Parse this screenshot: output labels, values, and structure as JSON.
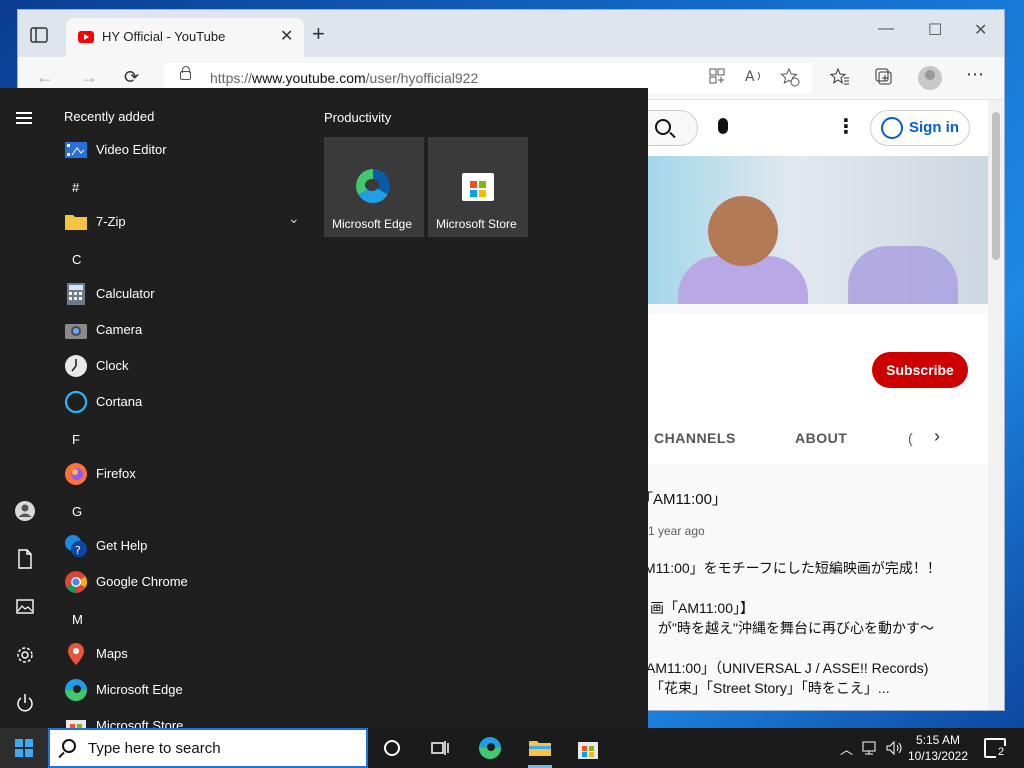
{
  "browser": {
    "tab_title": "HY Official - YouTube",
    "url_prefix": "https://",
    "url_host": "www.youtube.com",
    "url_path": "/user/hyofficial922",
    "close_tab": "✕",
    "new_tab": "+",
    "window_minimize": "—",
    "window_maximize": "☐",
    "window_close": "✕",
    "back": "←",
    "forward": "→",
    "refresh": "⟳",
    "more": "⋯"
  },
  "youtube": {
    "sign_in": "Sign in",
    "subscribe": "Subscribe",
    "tabs": [
      "CHANNELS",
      "ABOUT",
      "("
    ],
    "kebab": "⋮",
    "next": "›",
    "video_title": "「AM11:00」",
    "video_age": "1 year ago",
    "desc_lines": [
      "M11:00」をモチーフにした短編映画が完成！！",
      "画「AM11:00」】",
      "が\"時を越え\"沖縄を舞台に再び心を動かす～",
      "AM11:00」（UNIVERSAL J / ASSE!! Records)",
      "「花束」「Street Story」「時をこえ」..."
    ]
  },
  "start_menu": {
    "recently_added": "Recently added",
    "productivity": "Productivity",
    "apps": [
      {
        "label": "Video Editor",
        "icon": "video-editor-icon"
      },
      {
        "letter": "#"
      },
      {
        "label": "7-Zip",
        "icon": "folder-icon",
        "expand": "⌄"
      },
      {
        "letter": "C"
      },
      {
        "label": "Calculator",
        "icon": "calculator-icon"
      },
      {
        "label": "Camera",
        "icon": "camera-icon"
      },
      {
        "label": "Clock",
        "icon": "clock-icon"
      },
      {
        "label": "Cortana",
        "icon": "cortana-icon"
      },
      {
        "letter": "F"
      },
      {
        "label": "Firefox",
        "icon": "firefox-icon"
      },
      {
        "letter": "G"
      },
      {
        "label": "Get Help",
        "icon": "get-help-icon"
      },
      {
        "label": "Google Chrome",
        "icon": "chrome-icon"
      },
      {
        "letter": "M"
      },
      {
        "label": "Maps",
        "icon": "maps-icon"
      },
      {
        "label": "Microsoft Edge",
        "icon": "edge-icon"
      },
      {
        "label": "Microsoft Store",
        "icon": "store-icon"
      }
    ],
    "tiles": [
      "Microsoft Edge",
      "Microsoft Store"
    ]
  },
  "taskbar": {
    "search_placeholder": "Type here to search",
    "time": "5:15 AM",
    "date": "10/13/2022",
    "notification_count": "2"
  }
}
